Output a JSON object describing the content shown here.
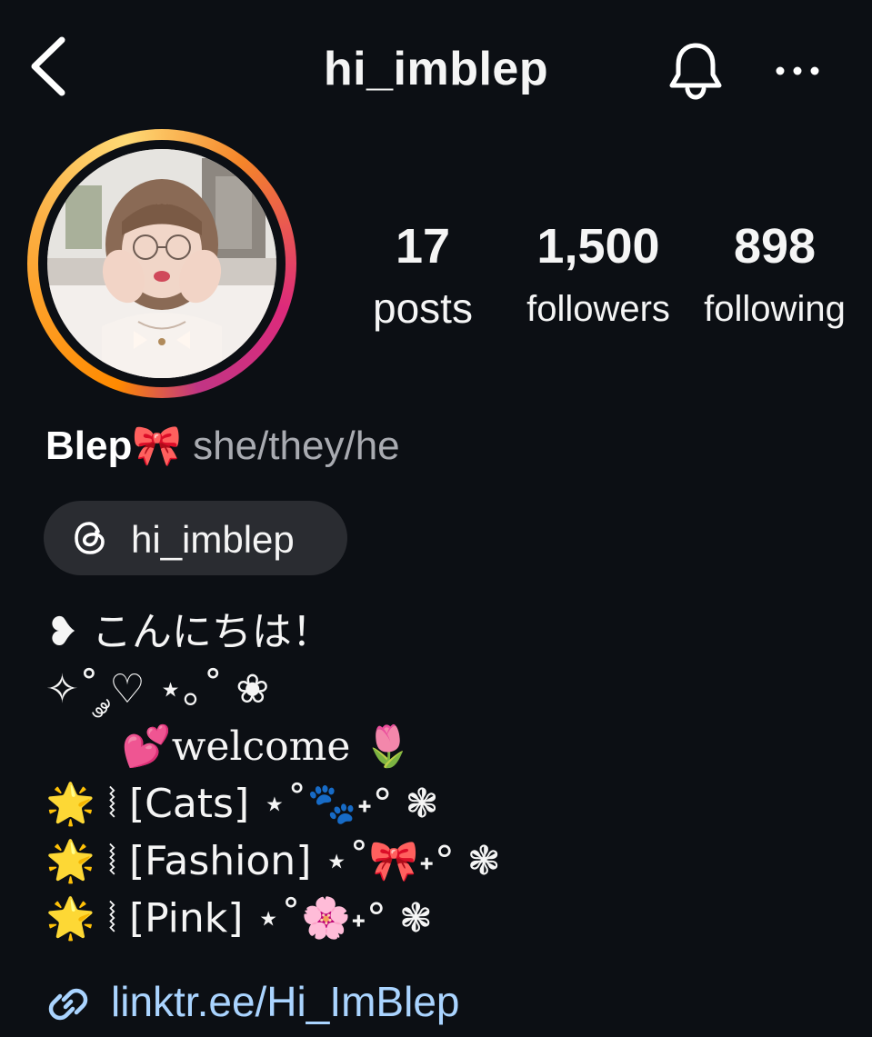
{
  "header": {
    "title": "hi_imblep",
    "back_icon": "chevron-left-icon",
    "bell_icon": "bell-icon",
    "more_icon": "more-horizontal-icon"
  },
  "profile": {
    "avatar_ring_colors": [
      "#feda75",
      "#fa7e1e",
      "#d62976",
      "#962fbf"
    ],
    "stats": {
      "posts": {
        "count": "17",
        "label": "posts"
      },
      "followers": {
        "count": "1,500",
        "label": "followers"
      },
      "following": {
        "count": "898",
        "label": "following"
      }
    },
    "display_name": "Blep🎀",
    "pronouns": "she/they/he"
  },
  "threads_badge": {
    "icon": "threads-icon",
    "label": "hi_imblep"
  },
  "bio": {
    "lines": [
      "❥ こんにちは！",
      "✧˚ ༘♡ ⋆｡˚ ❀",
      "      💕welcome 🌷",
      "🌟 ⦚ [Cats] ⋆˚🐾˖° ❃",
      "🌟 ⦚ [Fashion] ⋆˚🎀˖° ❃",
      "🌟 ⦚ [Pink] ⋆˚🌸˖° ❃"
    ]
  },
  "link": {
    "icon": "link-icon",
    "text": "linktr.ee/Hi_ImBlep",
    "color": "#aad4ff"
  }
}
